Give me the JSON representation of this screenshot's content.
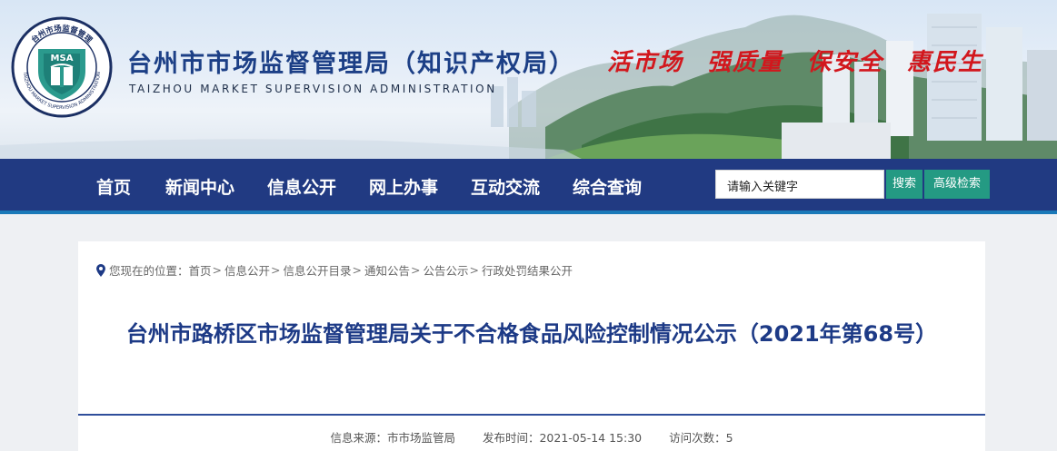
{
  "header": {
    "site_title": "台州市市场监督管理局（知识产权局）",
    "site_subtitle": "TAIZHOU MARKET SUPERVISION ADMINISTRATION",
    "logo_abbr": "MSA",
    "logo_ring_text": "TAIZHOU MARKET SUPERVISION ADMINISTRATION",
    "logo_cn_text": "台州市场监督管理",
    "slogans": [
      "活市场",
      "强质量",
      "保安全",
      "惠民生"
    ]
  },
  "nav": {
    "items": [
      "首页",
      "新闻中心",
      "信息公开",
      "网上办事",
      "互动交流",
      "综合查询"
    ],
    "search_placeholder": "请输入关键字",
    "search_button": "搜索",
    "advanced_button": "高级检索"
  },
  "breadcrumb": {
    "prefix": "您现在的位置：",
    "items": [
      "首页",
      "信息公开",
      "信息公开目录",
      "通知公告",
      "公告公示",
      "行政处罚结果公开"
    ],
    "separator": ">"
  },
  "article": {
    "title": "台州市路桥区市场监督管理局关于不合格食品风险控制情况公示（2021年第68号）",
    "source_label": "信息来源：",
    "source": "市市场监管局",
    "date_label": "发布时间：",
    "date": "2021-05-14 15:30",
    "visits_label": "访问次数：",
    "visits": "5"
  },
  "colors": {
    "nav_bg": "#213a82",
    "title_blue": "#1d3a86",
    "slogan_red": "#d2171d",
    "button_teal": "#249a83"
  }
}
